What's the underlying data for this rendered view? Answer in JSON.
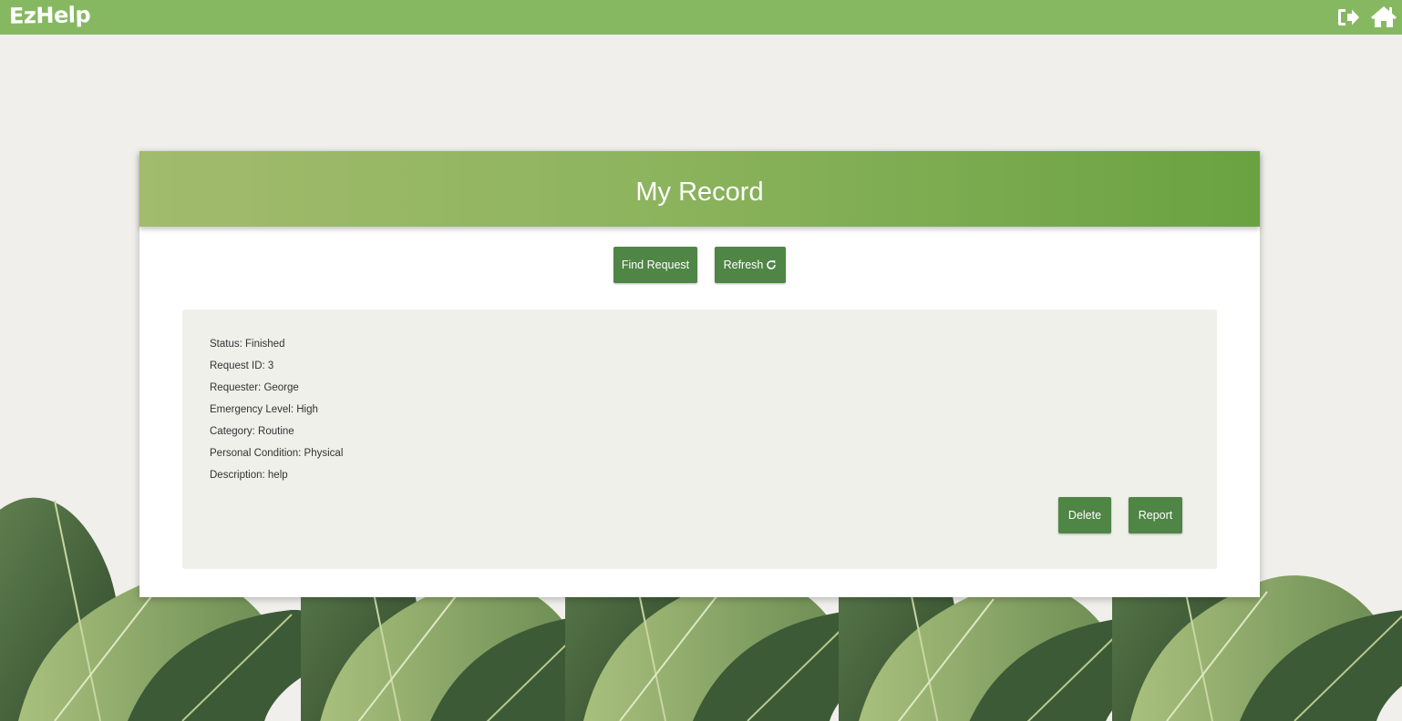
{
  "nav": {
    "logo": "EzHelp",
    "logout_icon": "logout-icon",
    "home_icon": "home-icon"
  },
  "card": {
    "title": "My Record",
    "find_request_label": "Find Request",
    "refresh_label": "Refresh",
    "refresh_icon": "refresh-icon"
  },
  "record": {
    "status": "Status: Finished",
    "request_id": "Request ID: 3",
    "requester": "Requester: George",
    "emergency_level": "Emergency Level: High",
    "category": "Category: Routine",
    "personal_condition": "Personal Condition: Physical",
    "description": "Description: help",
    "delete_label": "Delete",
    "report_label": "Report"
  },
  "colors": {
    "nav_bar": "#86b861",
    "button": "#4f8545",
    "panel": "#eff0ea",
    "page_bg": "#f0efeb"
  }
}
